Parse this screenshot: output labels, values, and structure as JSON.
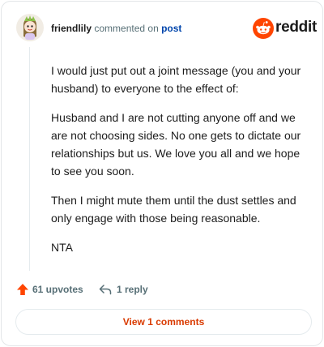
{
  "header": {
    "username": "friendlily",
    "action_text": "commented on",
    "post_link": "post",
    "brand": "reddit"
  },
  "comment": {
    "paragraphs": [
      "I would just put out a joint message (you and your husband) to everyone to the effect of:",
      "Husband and I are not cutting anyone off and we are not choosing sides. No one gets to dictate our relationships but us. We love you all and we hope to see you soon.",
      "Then I might mute them until the dust settles and only engage with those being reasonable.",
      "NTA"
    ]
  },
  "actions": {
    "upvotes_label": "61 upvotes",
    "replies_label": "1 reply"
  },
  "view_comments_label": "View 1 comments",
  "colors": {
    "brand_orange": "#ff4500",
    "link_blue": "#0045ac",
    "muted": "#576f76",
    "button_text": "#d93a00"
  }
}
